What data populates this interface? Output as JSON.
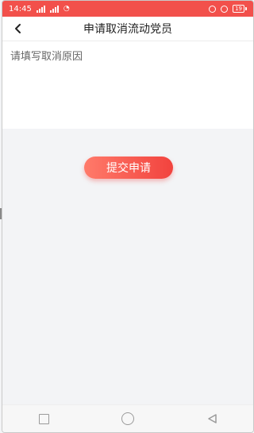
{
  "status_bar": {
    "time": "14:45",
    "battery": "19",
    "accent": "#f2504b"
  },
  "nav": {
    "title": "申请取消流动党员",
    "back_icon": "chevron-left-icon"
  },
  "reason_input": {
    "placeholder": "请填写取消原因"
  },
  "submit": {
    "label": "提交申请"
  },
  "system_nav": {
    "icons": [
      "square-icon",
      "circle-icon",
      "triangle-back-icon"
    ]
  }
}
